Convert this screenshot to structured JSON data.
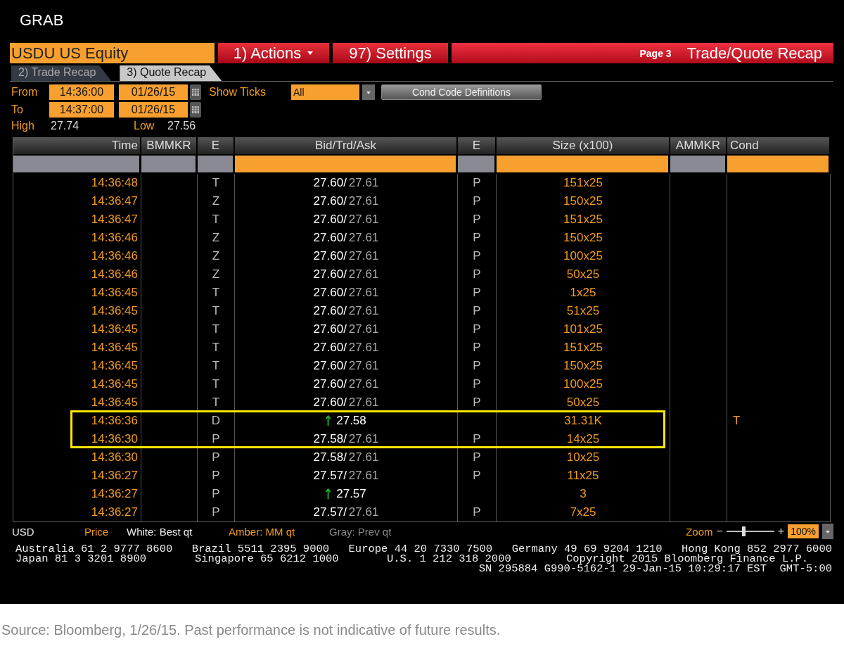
{
  "app_title": "GRAB",
  "toolbar": {
    "security": "USDU US Equity",
    "actions": "1) Actions",
    "settings": "97) Settings",
    "page": "Page 3",
    "title": "Trade/Quote Recap"
  },
  "tabs": [
    {
      "label": "2) Trade Recap",
      "selected": false
    },
    {
      "label": "3) Quote Recap",
      "selected": true
    }
  ],
  "range": {
    "from_label": "From",
    "from_time": "14:36:00",
    "from_date": "01/26/15",
    "to_label": "To",
    "to_time": "14:37:00",
    "to_date": "01/26/15",
    "show_ticks_label": "Show Ticks",
    "show_ticks": "All",
    "definitions_button": "Cond Code Definitions"
  },
  "stats": {
    "high_label": "High",
    "high": "27.74",
    "low_label": "Low",
    "low": "27.56"
  },
  "table": {
    "columns": [
      {
        "label": "Time",
        "filter_active": false
      },
      {
        "label": "BMMKR",
        "filter_active": false
      },
      {
        "label": "E",
        "filter_active": false
      },
      {
        "label": "Bid/Trd/Ask",
        "filter_active": true
      },
      {
        "label": "E",
        "filter_active": false
      },
      {
        "label": "Size (x100)",
        "filter_active": true
      },
      {
        "label": "AMMKR",
        "filter_active": false
      },
      {
        "label": "Cond",
        "filter_active": true
      }
    ],
    "rows": [
      {
        "kind": "quote",
        "time": "14:36:48",
        "exchange": "T",
        "bid": "27.60/",
        "ask": "27.61",
        "exchange_2": "P",
        "size": "151x25"
      },
      {
        "kind": "quote",
        "time": "14:36:47",
        "exchange": "Z",
        "bid": "27.60/",
        "ask": "27.61",
        "exchange_2": "P",
        "size": "150x25"
      },
      {
        "kind": "quote",
        "time": "14:36:47",
        "exchange": "T",
        "bid": "27.60/",
        "ask": "27.61",
        "exchange_2": "P",
        "size": "151x25"
      },
      {
        "kind": "quote",
        "time": "14:36:46",
        "exchange": "Z",
        "bid": "27.60/",
        "ask": "27.61",
        "exchange_2": "P",
        "size": "150x25"
      },
      {
        "kind": "quote",
        "time": "14:36:46",
        "exchange": "Z",
        "bid": "27.60/",
        "ask": "27.61",
        "exchange_2": "P",
        "size": "100x25"
      },
      {
        "kind": "quote",
        "time": "14:36:46",
        "exchange": "Z",
        "bid": "27.60/",
        "ask": "27.61",
        "exchange_2": "P",
        "size": "50x25"
      },
      {
        "kind": "quote",
        "time": "14:36:45",
        "exchange": "T",
        "bid": "27.60/",
        "ask": "27.61",
        "exchange_2": "P",
        "size": "1x25"
      },
      {
        "kind": "quote",
        "time": "14:36:45",
        "exchange": "T",
        "bid": "27.60/",
        "ask": "27.61",
        "exchange_2": "P",
        "size": "51x25"
      },
      {
        "kind": "quote",
        "time": "14:36:45",
        "exchange": "T",
        "bid": "27.60/",
        "ask": "27.61",
        "exchange_2": "P",
        "size": "101x25"
      },
      {
        "kind": "quote",
        "time": "14:36:45",
        "exchange": "T",
        "bid": "27.60/",
        "ask": "27.61",
        "exchange_2": "P",
        "size": "151x25"
      },
      {
        "kind": "quote",
        "time": "14:36:45",
        "exchange": "T",
        "bid": "27.60/",
        "ask": "27.61",
        "exchange_2": "P",
        "size": "150x25"
      },
      {
        "kind": "quote",
        "time": "14:36:45",
        "exchange": "T",
        "bid": "27.60/",
        "ask": "27.61",
        "exchange_2": "P",
        "size": "100x25"
      },
      {
        "kind": "quote",
        "time": "14:36:45",
        "exchange": "T",
        "bid": "27.60/",
        "ask": "27.61",
        "exchange_2": "P",
        "size": "50x25"
      },
      {
        "kind": "highlight",
        "rows": [
          {
            "kind": "trade",
            "time": "14:36:36",
            "exchange": "D",
            "price": "27.58",
            "size": "31.31K",
            "cond": "T"
          },
          {
            "kind": "quote",
            "time": "14:36:30",
            "exchange": "P",
            "bid": "27.58/",
            "ask": "27.61",
            "exchange_2": "P",
            "size": "14x25"
          }
        ]
      },
      {
        "kind": "quote",
        "time": "14:36:30",
        "exchange": "P",
        "bid": "27.58/",
        "ask": "27.61",
        "exchange_2": "P",
        "size": "10x25"
      },
      {
        "kind": "quote",
        "time": "14:36:27",
        "exchange": "P",
        "bid": "27.57/",
        "ask": "27.61",
        "exchange_2": "P",
        "size": "11x25"
      },
      {
        "kind": "trade",
        "time": "14:36:27",
        "exchange": "P",
        "price": "27.57",
        "size": "3"
      },
      {
        "kind": "quote",
        "time": "14:36:27",
        "exchange": "P",
        "bid": "27.57/",
        "ask": "27.61",
        "exchange_2": "P",
        "size": "7x25"
      }
    ]
  },
  "legend": {
    "currency": "USD",
    "price": "Price",
    "white": "White: Best qt",
    "amber": "Amber: MM qt",
    "gray": "Gray: Prev qt",
    "zoom_label": "Zoom",
    "zoom_minus": "−",
    "zoom_plus": "+",
    "zoom": {
      "level": 0.35
    },
    "zoom_value": "100%"
  },
  "contacts": [
    [
      "Australia 61 2 9777 8600",
      "Brazil 5511 2395 9000",
      "Europe 44 20 7330 7500",
      "Germany 49 69 9204 1210",
      "Hong Kong 852 2977 6000"
    ],
    [
      "Japan 81 3 3201 8900",
      "Singapore 65 6212 1000",
      "U.S. 1 212 318 2000",
      "Copyright 2015 Bloomberg Finance L.P."
    ],
    [
      "SN 295884 G990-5162-1 29-Jan-15 10:29:17 EST  GMT-5:00"
    ]
  ],
  "source_note": "Source: Bloomberg, 1/26/15. Past performance is not indicative of future results."
}
